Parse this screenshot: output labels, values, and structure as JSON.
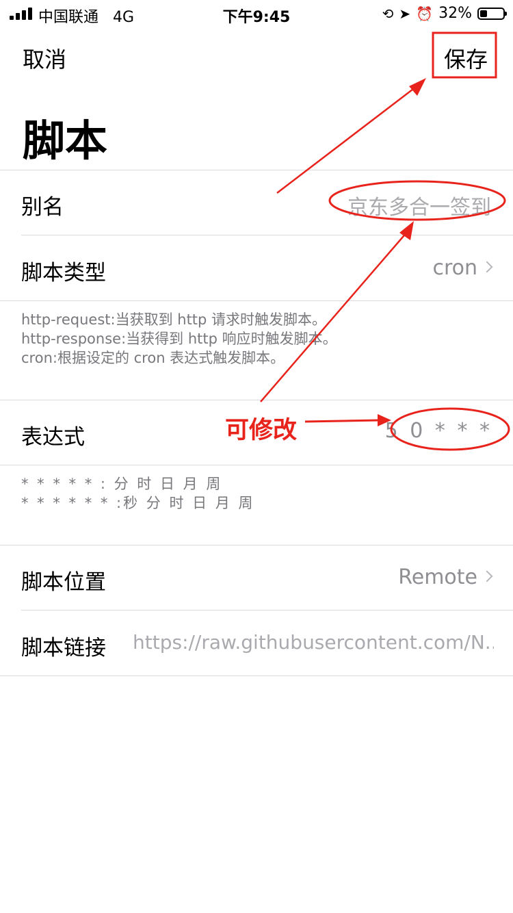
{
  "status_bar": {
    "carrier": "中国联通",
    "network": "4G",
    "time": "下午9:45",
    "battery": "32%",
    "battery_level": 0.32
  },
  "nav": {
    "cancel": "取消",
    "save": "保存"
  },
  "page_title": "脚本",
  "rows": {
    "alias": {
      "label": "别名",
      "value": "京东多合一签到"
    },
    "type": {
      "label": "脚本类型",
      "value": "cron"
    },
    "expression": {
      "label": "表达式",
      "value": "5 0 * * *"
    },
    "location": {
      "label": "脚本位置",
      "value": "Remote"
    },
    "link": {
      "label": "脚本链接",
      "value": "https://raw.githubusercontent.com/N..."
    }
  },
  "notes": {
    "type_help": "http-request:当获取到 http 请求时触发脚本。\nhttp-response:当获得到 http 响应时触发脚本。\ncron:根据设定的 cron 表达式触发脚本。",
    "cron_help": "* * * * * : 分 时 日 月 周\n* * * * * * :秒 分 时 日 月 周"
  },
  "annotation": {
    "text": "可修改",
    "color": "#e8231c"
  }
}
